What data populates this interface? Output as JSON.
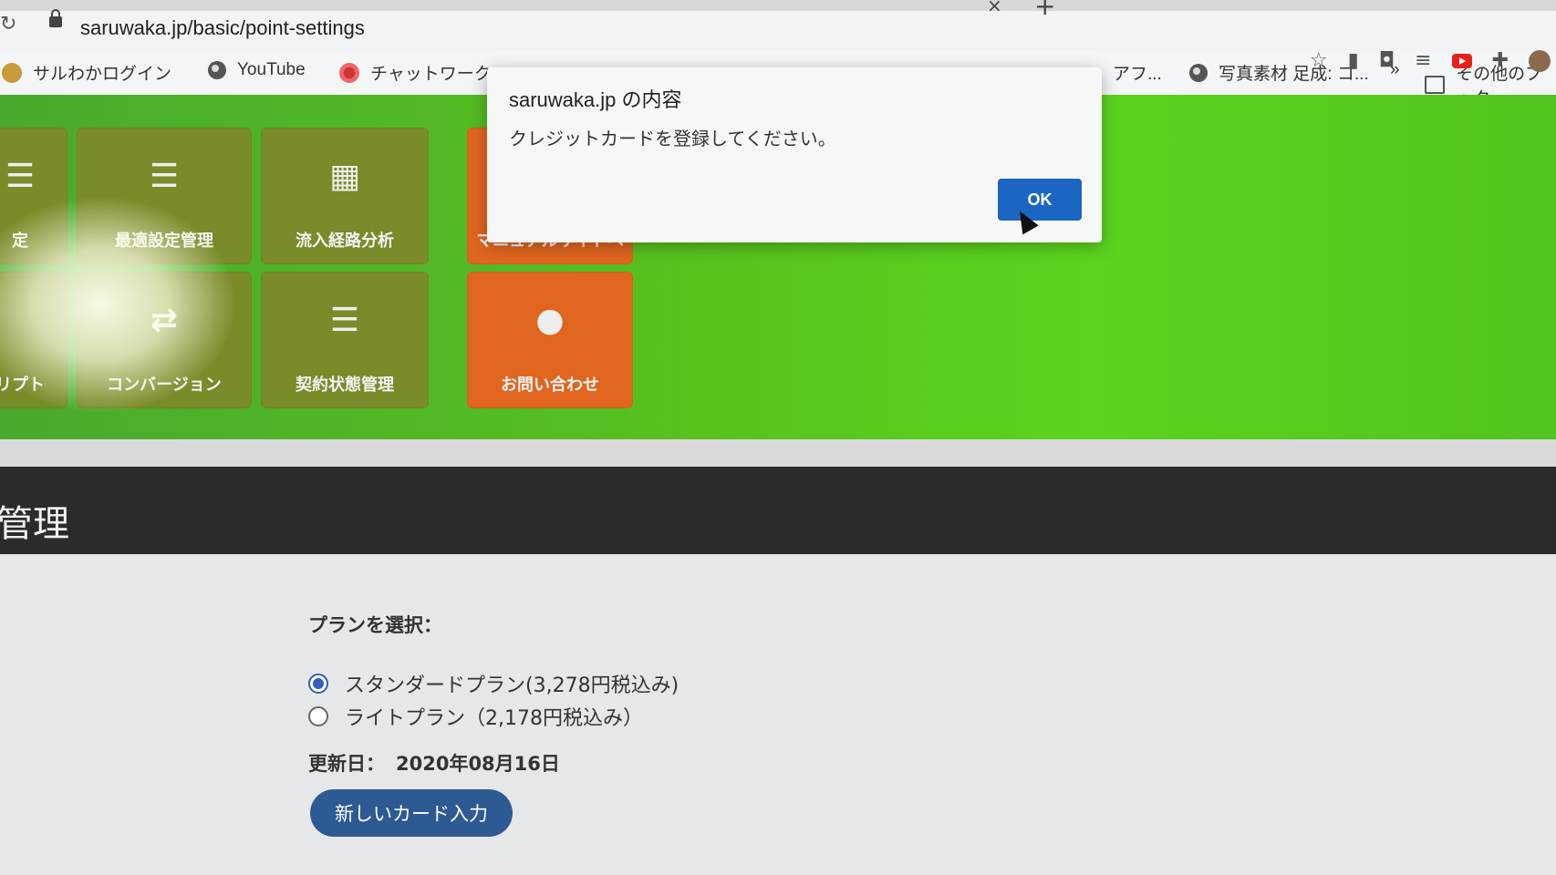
{
  "browser": {
    "url": "saruwaka.jp/basic/point-settings",
    "bookmarks": [
      {
        "label": "サルわかログイン",
        "icon": "saruwaka-favicon"
      },
      {
        "label": "YouTube",
        "icon": "globe-icon"
      },
      {
        "label": "チャットワーク",
        "icon": "chatwork-icon"
      },
      {
        "label": "アフ...",
        "icon": "bookmark-icon"
      },
      {
        "label": "写真素材 足成: コ...",
        "icon": "globe-icon"
      },
      {
        "label": "»",
        "icon": "overflow-icon"
      },
      {
        "label": "その他のブック",
        "icon": "folder-icon"
      }
    ]
  },
  "hero": {
    "tiles": [
      {
        "label": "定",
        "icon": "list-icon"
      },
      {
        "label": "最適設定管理",
        "icon": "list-icon"
      },
      {
        "label": "流入経路分析",
        "icon": "qr-icon"
      },
      {
        "label": "マニュアルサイトへ",
        "icon": "book-icon"
      },
      {
        "label": "リプト",
        "icon": "code-icon"
      },
      {
        "label": "コンバージョン",
        "icon": "swap-icon"
      },
      {
        "label": "契約状態管理",
        "icon": "list-icon"
      },
      {
        "label": "お問い合わせ",
        "icon": "speech-bubble-icon"
      }
    ]
  },
  "section": {
    "title": "管理"
  },
  "plan": {
    "heading": "プランを選択：",
    "options": [
      {
        "label": "スタンダードプラン(3,278円税込み)",
        "selected": true
      },
      {
        "label": "ライトプラン（2,178円税込み）",
        "selected": false
      }
    ],
    "updated_label": "更新日：",
    "updated_value": "2020年08月16日",
    "new_card_button": "新しいカード入力"
  },
  "alert": {
    "title": "saruwaka.jp の内容",
    "message": "クレジットカードを登録してください。",
    "ok_label": "OK"
  },
  "colors": {
    "hero_green": "#57c21e",
    "tile_olive": "#7a8b2a",
    "tile_orange": "#e0661f",
    "ok_button": "#1a66c2",
    "card_button": "#2e5a93"
  }
}
